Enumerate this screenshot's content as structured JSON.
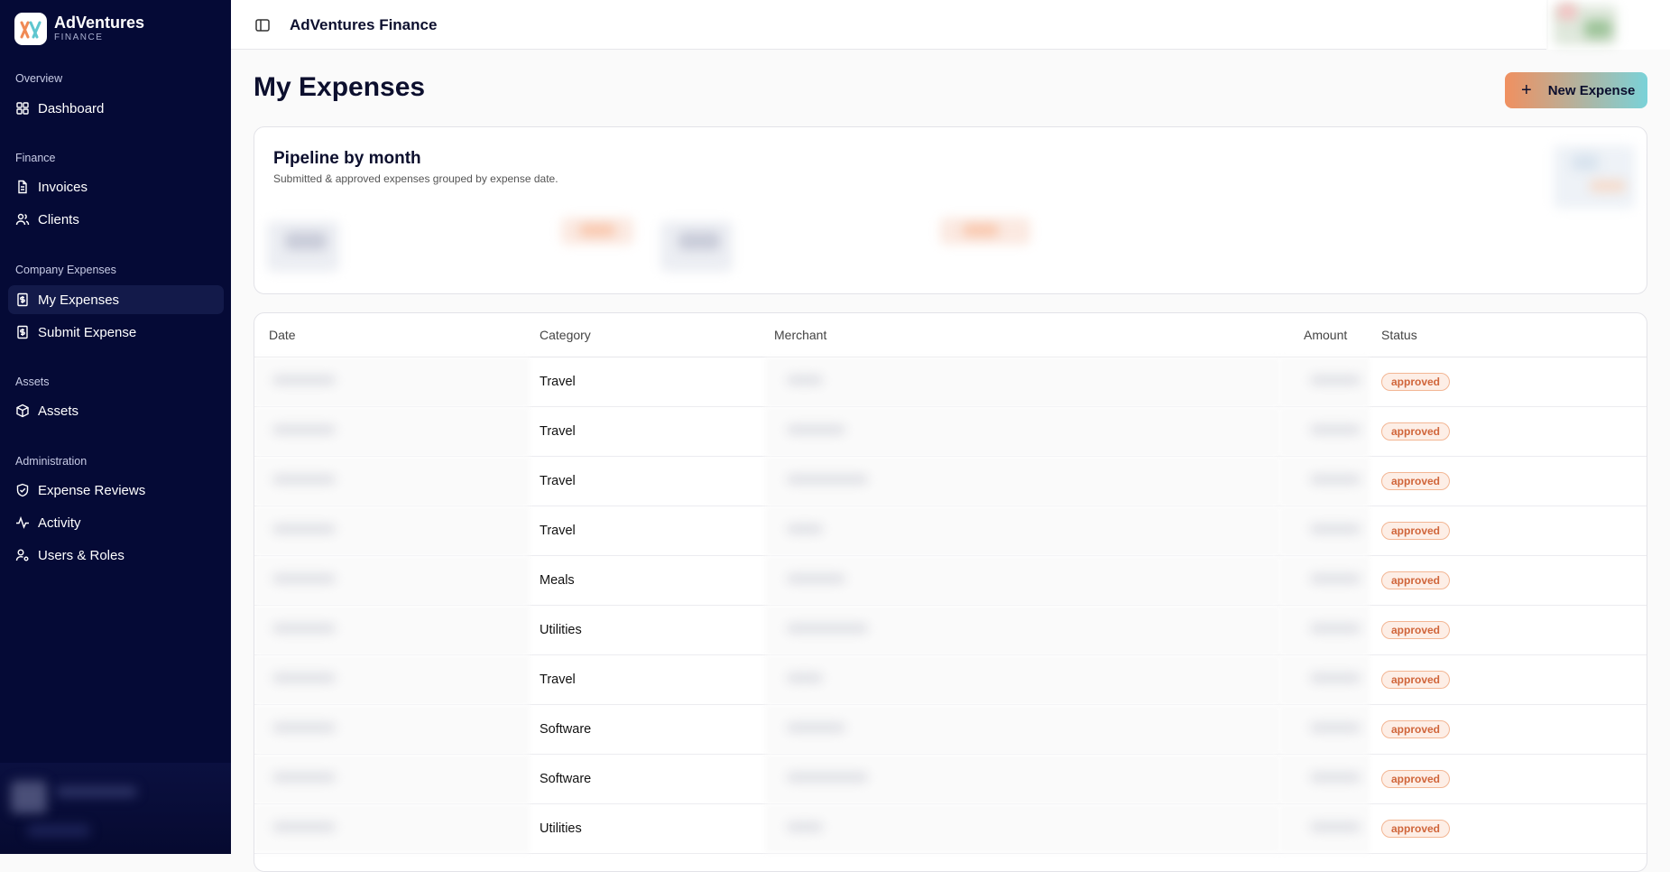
{
  "brand": {
    "name": "AdVentures",
    "sub": "FINANCE"
  },
  "sidebar": {
    "sections": [
      {
        "label": "Overview",
        "items": [
          {
            "label": "Dashboard",
            "icon": "grid-icon"
          }
        ]
      },
      {
        "label": "Finance",
        "items": [
          {
            "label": "Invoices",
            "icon": "document-icon"
          },
          {
            "label": "Clients",
            "icon": "users-icon"
          }
        ]
      },
      {
        "label": "Company Expenses",
        "items": [
          {
            "label": "My Expenses",
            "icon": "receipt-icon",
            "active": true
          },
          {
            "label": "Submit Expense",
            "icon": "receipt-icon"
          }
        ]
      },
      {
        "label": "Assets",
        "items": [
          {
            "label": "Assets",
            "icon": "box-icon"
          }
        ]
      },
      {
        "label": "Administration",
        "items": [
          {
            "label": "Expense Reviews",
            "icon": "shield-icon"
          },
          {
            "label": "Activity",
            "icon": "activity-icon"
          },
          {
            "label": "Users & Roles",
            "icon": "user-cog-icon"
          }
        ]
      }
    ]
  },
  "topbar": {
    "title": "AdVentures Finance"
  },
  "page": {
    "title": "My Expenses",
    "new_button": "New Expense"
  },
  "pipeline": {
    "title": "Pipeline by month",
    "subtitle": "Submitted & approved expenses grouped by expense date."
  },
  "table": {
    "headers": {
      "date": "Date",
      "category": "Category",
      "merchant": "Merchant",
      "amount": "Amount",
      "status": "Status"
    },
    "rows": [
      {
        "category": "Travel",
        "status": "approved"
      },
      {
        "category": "Travel",
        "status": "approved"
      },
      {
        "category": "Travel",
        "status": "approved"
      },
      {
        "category": "Travel",
        "status": "approved"
      },
      {
        "category": "Meals",
        "status": "approved"
      },
      {
        "category": "Utilities",
        "status": "approved"
      },
      {
        "category": "Travel",
        "status": "approved"
      },
      {
        "category": "Software",
        "status": "approved"
      },
      {
        "category": "Software",
        "status": "approved"
      },
      {
        "category": "Utilities",
        "status": "approved"
      }
    ]
  },
  "colors": {
    "sidebar_bg": "#050a36",
    "accent_orange": "#f09060",
    "accent_teal": "#7ad2d8",
    "badge_text": "#d0653a"
  }
}
